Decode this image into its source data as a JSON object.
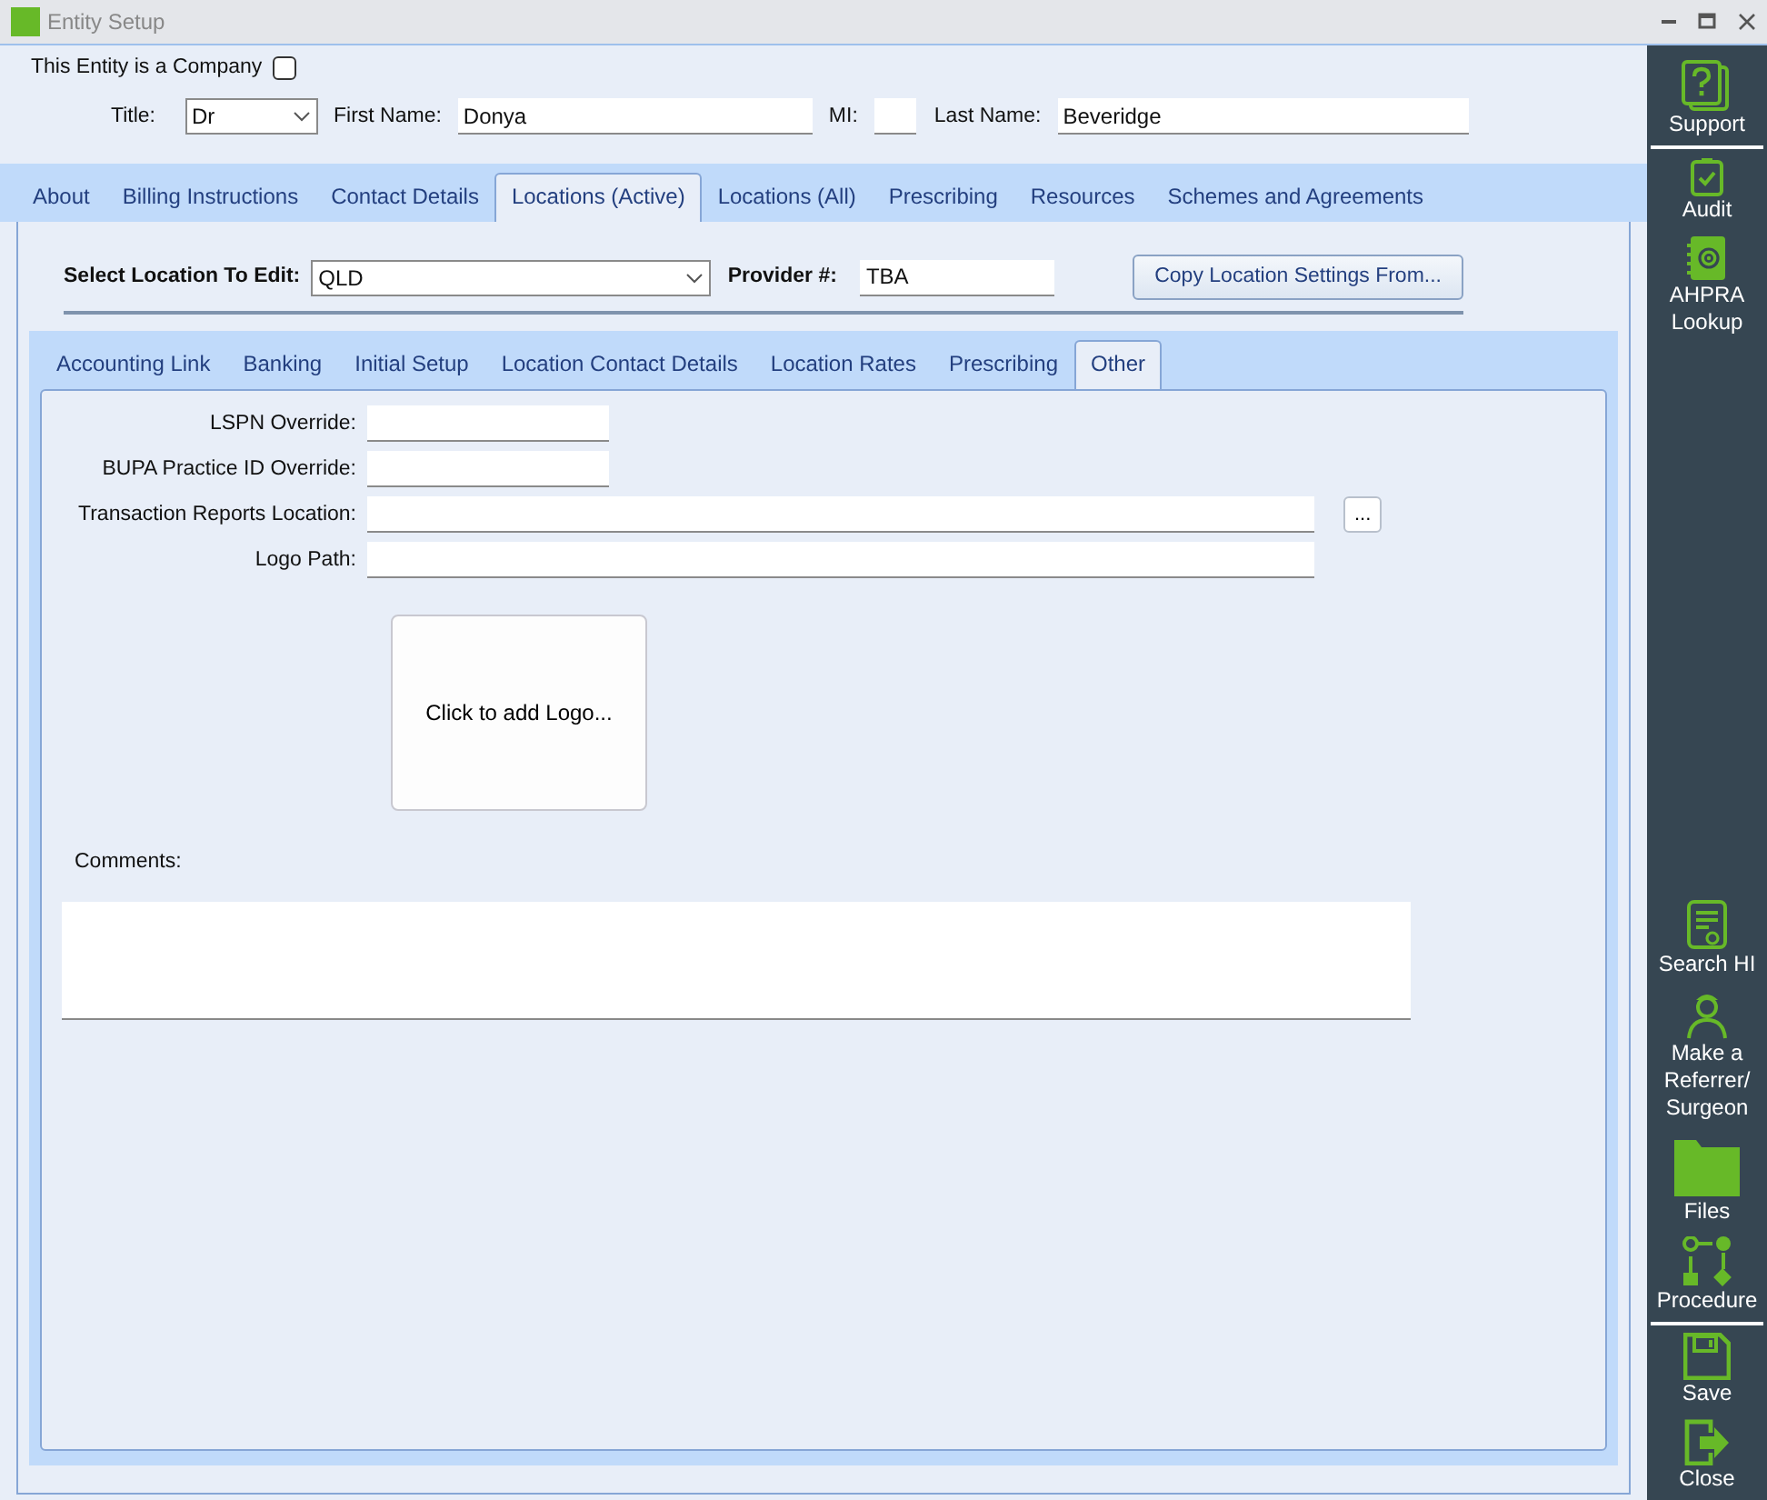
{
  "window": {
    "title": "Entity Setup"
  },
  "company": {
    "label": "This Entity is a Company",
    "checked": false
  },
  "name_row": [
    {
      "kind": "select",
      "label": "Title:",
      "value": "Dr"
    },
    {
      "kind": "text",
      "label": "First Name:",
      "value": "Donya"
    },
    {
      "kind": "short",
      "label": "MI:"
    },
    {
      "kind": "text",
      "label": "Last Name:",
      "value": "Beveridge"
    }
  ],
  "tabs": [
    {
      "label": "About",
      "selected": false
    },
    {
      "label": "Billing Instructions",
      "selected": false
    },
    {
      "label": "Contact Details",
      "selected": false
    },
    {
      "label": "Locations (Active)",
      "selected": true
    },
    {
      "label": "Locations (All)",
      "selected": false
    },
    {
      "label": "Prescribing",
      "selected": false
    },
    {
      "label": "Resources",
      "selected": false
    },
    {
      "label": "Schemes and Agreements",
      "selected": false
    }
  ],
  "location": {
    "select_label": "Select Location To Edit:",
    "select_value": "QLD",
    "provider_label": "Provider #:",
    "provider_value": "TBA",
    "copy_button": "Copy Location Settings From..."
  },
  "sub_tabs": [
    {
      "label": "Accounting Link",
      "selected": false
    },
    {
      "label": "Banking",
      "selected": false
    },
    {
      "label": "Initial Setup",
      "selected": false
    },
    {
      "label": "Location Contact Details",
      "selected": false
    },
    {
      "label": "Location Rates",
      "selected": false
    },
    {
      "label": "Prescribing",
      "selected": false
    },
    {
      "label": "Other",
      "selected": true
    }
  ],
  "fields": [
    {
      "kind": "short",
      "label": "LSPN Override:"
    },
    {
      "kind": "short",
      "label": "BUPA Practice ID Override:"
    },
    {
      "kind": "browse",
      "label": "Transaction Reports Location:",
      "button": "..."
    },
    {
      "kind": "long",
      "label": "Logo Path:"
    }
  ],
  "logo_box": {
    "label": "Click to add Logo..."
  },
  "comments": {
    "label": "Comments:"
  },
  "sidebar": {
    "top_groups": [
      [
        {
          "label": "Support"
        }
      ],
      [
        {
          "label": "Audit"
        },
        {
          "label": "AHPRA Lookup"
        }
      ]
    ],
    "bottom_groups": [
      [
        {
          "label": "Search HI"
        },
        {
          "label": "Make a Referrer/ Surgeon"
        },
        {
          "label": "Files"
        },
        {
          "label": "Procedure"
        }
      ],
      [
        {
          "label": "Save"
        },
        {
          "label": "Close"
        }
      ]
    ]
  }
}
